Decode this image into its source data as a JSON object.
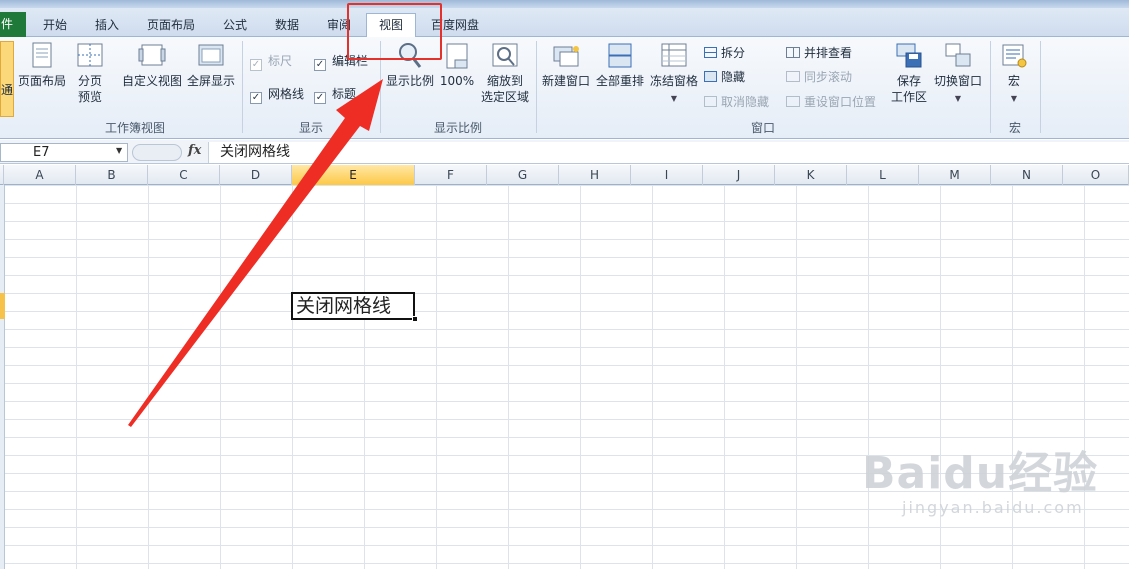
{
  "tabs": [
    {
      "label": "件",
      "active": false,
      "file": true
    },
    {
      "label": "开始",
      "active": false
    },
    {
      "label": "插入",
      "active": false
    },
    {
      "label": "页面布局",
      "active": false
    },
    {
      "label": "公式",
      "active": false
    },
    {
      "label": "数据",
      "active": false
    },
    {
      "label": "审阅",
      "active": false
    },
    {
      "label": "视图",
      "active": true
    },
    {
      "label": "百度网盘",
      "active": false
    }
  ],
  "ribbon": {
    "workbook_views": {
      "group_label": "工作簿视图",
      "page_layout": "页面布局",
      "page_break_line1": "分页",
      "page_break_line2": "预览",
      "custom_views": "自定义视图",
      "full_screen": "全屏显示"
    },
    "show": {
      "group_label": "显示",
      "ruler": "标尺",
      "formula_bar": "编辑栏",
      "gridlines": "网格线",
      "headings": "标题",
      "ruler_checked": true,
      "formula_bar_checked": true,
      "gridlines_checked": true,
      "headings_checked": true
    },
    "zoom": {
      "group_label": "显示比例",
      "zoom": "显示比例",
      "zoom_100": "100%",
      "zoom_selection_line1": "缩放到",
      "zoom_selection_line2": "选定区域"
    },
    "window": {
      "group_label": "窗口",
      "new_window": "新建窗口",
      "arrange_all": "全部重排",
      "freeze_panes": "冻结窗格",
      "split": "拆分",
      "hide": "隐藏",
      "unhide": "取消隐藏",
      "side_by_side": "并排查看",
      "sync_scroll": "同步滚动",
      "reset_position": "重设窗口位置",
      "save_workspace_line1": "保存",
      "save_workspace_line2": "工作区",
      "switch_windows": "切换窗口"
    },
    "macros": {
      "group_label": "宏",
      "macros": "宏"
    }
  },
  "formula_bar": {
    "name_box": "E7",
    "fx": "fx",
    "content": "关闭网格线"
  },
  "sheet": {
    "columns": [
      "A",
      "B",
      "C",
      "D",
      "E",
      "F",
      "G",
      "H",
      "I",
      "J",
      "K",
      "L",
      "M",
      "N",
      "O"
    ],
    "selected_column": "E",
    "active_cell_text": "关闭网格线"
  },
  "watermark": {
    "brand": "Baidu经验",
    "url": "jingyan.baidu.com"
  },
  "colors": {
    "accent_red": "#e4312b",
    "file_tab": "#1f7a3a",
    "selection": "#fcc847"
  }
}
